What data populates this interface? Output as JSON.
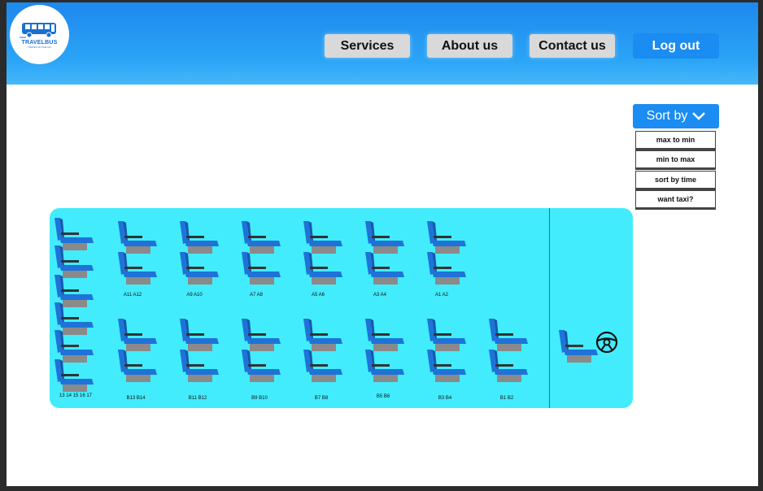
{
  "header": {
    "logo": {
      "icon": "bus-icon",
      "text": "TRAVELBUS",
      "subtext": "TRAVEL ON THE GO"
    },
    "nav": [
      {
        "label": "Services"
      },
      {
        "label": "About us"
      },
      {
        "label": "Contact us"
      }
    ],
    "logout_label": "Log out"
  },
  "sort": {
    "label": "Sort by",
    "icon": "chevron-down-icon",
    "options": [
      {
        "label": "max to min"
      },
      {
        "label": "min to max"
      },
      {
        "label": "sort by time"
      },
      {
        "label": "want taxi?"
      }
    ]
  },
  "bus": {
    "top_row_labels": [
      "A11 A12",
      "A9 A10",
      "A7 A8",
      "A5 A6",
      "A3 A4",
      "A1 A2"
    ],
    "bottom_row_labels": [
      "B13 B14",
      "B11 B12",
      "B9 B10",
      "B7 B8",
      "B5 B6",
      "B3 B4",
      "B1 B2"
    ],
    "back_row_label": "13 14 15 16 17",
    "driver_icon": "steering-wheel-icon",
    "colors": {
      "floor": "#42ecfc",
      "seat_blue": "#1f73d8",
      "seat_base": "#8a8a8a"
    }
  }
}
